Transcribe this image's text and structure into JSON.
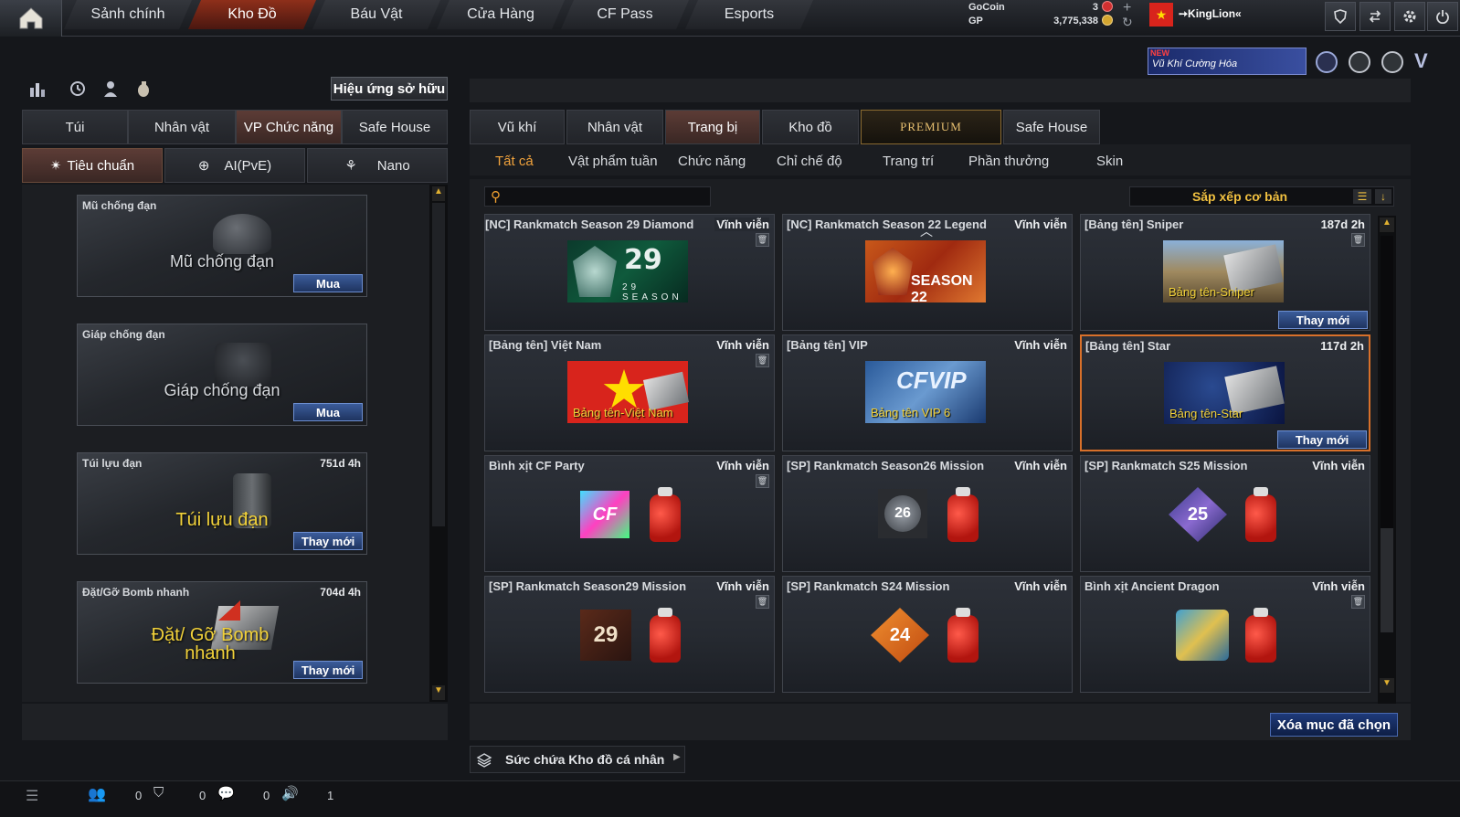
{
  "topnav": {
    "tabs": [
      "Sảnh chính",
      "Kho Đồ",
      "Báu Vật",
      "Cửa Hàng",
      "CF Pass",
      "Esports"
    ],
    "active": 1
  },
  "currency": {
    "gocoin_label": "GoCoin",
    "gocoin_value": "3",
    "gp_label": "GP",
    "gp_value": "3,775,338"
  },
  "user": {
    "name": "➙KingLion«",
    "flag_color": "#d8241c"
  },
  "promo": {
    "badge": "NEW",
    "text": "Vũ Khí Cường Hóa"
  },
  "left": {
    "effects_button": "Hiệu ứng sở hữu",
    "tabs": [
      "Túi",
      "Nhân vật",
      "VP Chức năng",
      "Safe House"
    ],
    "active_tab": 2,
    "modes": [
      "Tiêu chuẩn",
      "AI(PvE)",
      "Nano"
    ],
    "active_mode": 0,
    "items": [
      {
        "title": "Mũ chống đạn",
        "duration": "",
        "caption": "Mũ chống đạn",
        "button": "Mua"
      },
      {
        "title": "Giáp chống đạn",
        "duration": "",
        "caption": "Giáp chống đạn",
        "button": "Mua"
      },
      {
        "title": "Túi lựu đạn",
        "duration": "751d 4h",
        "caption": "Túi lựu đạn",
        "button": "Thay mới"
      },
      {
        "title": "Đặt/Gỡ Bomb nhanh",
        "duration": "704d 4h",
        "caption": "Đặt/ Gỡ Bomb nhanh",
        "button": "Thay mới"
      }
    ]
  },
  "right": {
    "tabs": [
      "Vũ khí",
      "Nhân vật",
      "Trang bị",
      "Kho đồ",
      "PREMIUM",
      "Safe House"
    ],
    "active_tab": 2,
    "subtabs": [
      "Tất cả",
      "Vật phẩm tuần",
      "Chức năng",
      "Chỉ chế độ",
      "Trang trí",
      "Phần thưởng",
      "Skin"
    ],
    "active_subtab": 0,
    "search_placeholder": "",
    "sort_label": "Sắp xếp cơ bản",
    "cards": [
      {
        "title": "[NC] Rankmatch Season 29 Diamond",
        "duration": "Vĩnh viễn",
        "label": "29 SEASON",
        "button": ""
      },
      {
        "title": "[NC] Rankmatch Season 22 Legend",
        "duration": "Vĩnh viễn",
        "label": "SEASON 22",
        "button": ""
      },
      {
        "title": "[Bảng tên] Sniper",
        "duration": "187d 2h",
        "label": "Bảng tên-Sniper",
        "button": "Thay mới"
      },
      {
        "title": "[Bảng tên] Việt Nam",
        "duration": "Vĩnh viễn",
        "label": "Bảng tên-Việt Nam",
        "button": ""
      },
      {
        "title": "[Bảng tên] VIP",
        "duration": "Vĩnh viễn",
        "label": "Bảng tên VIP 6",
        "button": ""
      },
      {
        "title": "[Bảng tên] Star",
        "duration": "117d 2h",
        "label": "Bảng tên-Star",
        "button": "Thay mới"
      },
      {
        "title": "Bình xịt CF Party",
        "duration": "Vĩnh viễn",
        "label": "CF",
        "button": ""
      },
      {
        "title": "[SP] Rankmatch Season26 Mission",
        "duration": "Vĩnh viễn",
        "label": "26",
        "button": ""
      },
      {
        "title": "[SP] Rankmatch S25 Mission",
        "duration": "Vĩnh viễn",
        "label": "25",
        "button": ""
      },
      {
        "title": "[SP] Rankmatch Season29 Mission",
        "duration": "Vĩnh viễn",
        "label": "29",
        "button": ""
      },
      {
        "title": "[SP] Rankmatch S24 Mission",
        "duration": "Vĩnh viễn",
        "label": "24",
        "button": ""
      },
      {
        "title": "Bình xịt Ancient Dragon",
        "duration": "Vĩnh viễn",
        "label": "",
        "button": ""
      }
    ],
    "delete_button": "Xóa mục đã chọn",
    "capacity_label": "Sức chứa Kho đồ cá nhân"
  },
  "statusbar": {
    "counts": [
      "0",
      "0",
      "0",
      "1"
    ]
  }
}
